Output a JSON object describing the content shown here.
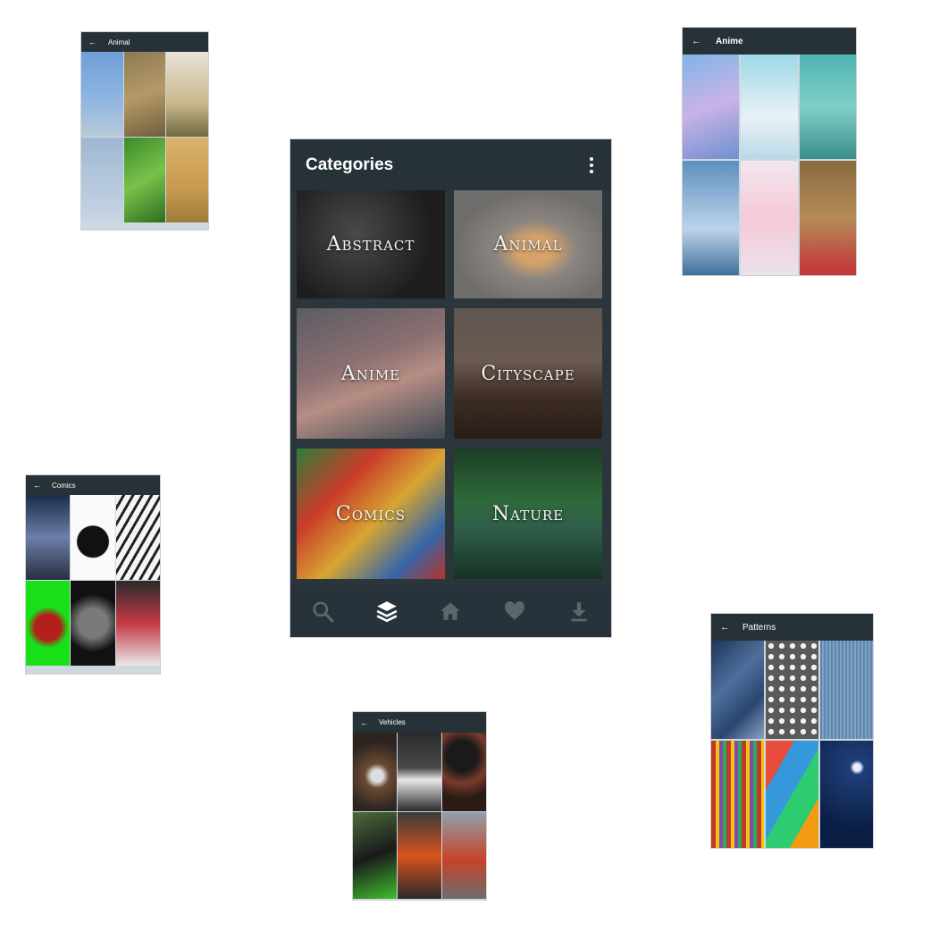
{
  "screens": {
    "animal": {
      "title": "Animal",
      "back": "←"
    },
    "anime": {
      "title": "Anime",
      "back": "←"
    },
    "comics": {
      "title": "Comics",
      "back": "←"
    },
    "vehicles": {
      "title": "Vehicles",
      "back": "←"
    },
    "patterns": {
      "title": "Patterns",
      "back": "←"
    }
  },
  "main": {
    "title": "Categories",
    "categories": [
      {
        "label": "Abstract"
      },
      {
        "label": "Animal"
      },
      {
        "label": "Anime"
      },
      {
        "label": "Cityscape"
      },
      {
        "label": "Comics"
      },
      {
        "label": "Nature"
      }
    ],
    "nav": [
      "search-icon",
      "layers-icon",
      "home-icon",
      "heart-icon",
      "download-icon"
    ]
  },
  "colors": {
    "appbar": "#263238",
    "nav_active": "#ffffff",
    "nav_inactive": "#5b676d"
  }
}
